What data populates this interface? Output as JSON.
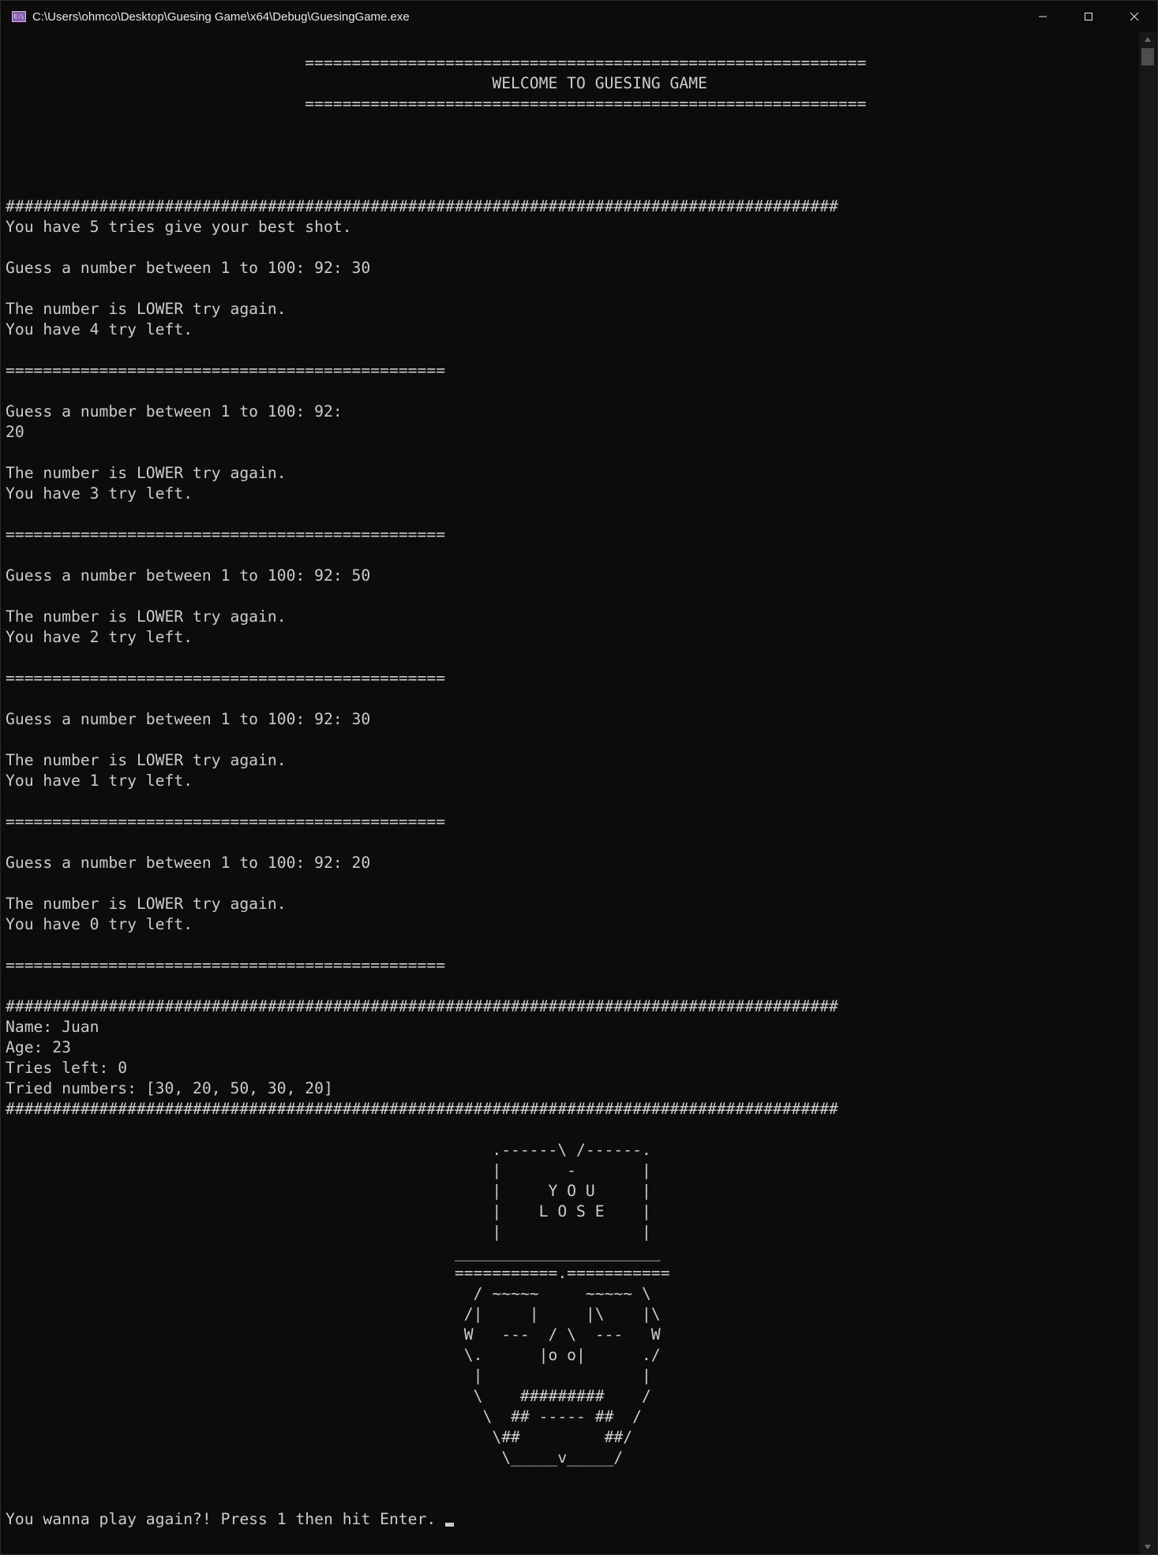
{
  "window": {
    "title": "C:\\Users\\ohmco\\Desktop\\Guesing Game\\x64\\Debug\\GuesingGame.exe",
    "icon": "console-app-icon",
    "icon_text": "C:\\",
    "controls": [
      "minimize-icon",
      "maximize-icon",
      "close-icon"
    ]
  },
  "console": {
    "lines": [
      "",
      "                                ============================================================",
      "                                                    WELCOME TO GUESING GAME",
      "                                ============================================================",
      "",
      "",
      "",
      "",
      "#########################################################################################",
      "You have 5 tries give your best shot.",
      "",
      "Guess a number between 1 to 100: 92: 30",
      "",
      "The number is LOWER try again.",
      "You have 4 try left.",
      "",
      "===============================================",
      "",
      "Guess a number between 1 to 100: 92:",
      "20",
      "",
      "The number is LOWER try again.",
      "You have 3 try left.",
      "",
      "===============================================",
      "",
      "Guess a number between 1 to 100: 92: 50",
      "",
      "The number is LOWER try again.",
      "You have 2 try left.",
      "",
      "===============================================",
      "",
      "Guess a number between 1 to 100: 92: 30",
      "",
      "The number is LOWER try again.",
      "You have 1 try left.",
      "",
      "===============================================",
      "",
      "Guess a number between 1 to 100: 92: 20",
      "",
      "The number is LOWER try again.",
      "You have 0 try left.",
      "",
      "===============================================",
      "",
      "#########################################################################################",
      "Name: Juan",
      "Age: 23",
      "Tries left: 0",
      "Tried numbers: [30, 20, 50, 30, 20]",
      "#########################################################################################",
      "",
      "                                                    .------\\ /------.",
      "                                                    |       -       |",
      "                                                    |     Y O U     |",
      "                                                    |    L O S E    |",
      "                                                    |               |",
      "                                                ______________________",
      "                                                ===========.===========",
      "                                                  / ~~~~~     ~~~~~ \\",
      "                                                 /|     |     |\\    |\\",
      "                                                 W   ---  / \\  ---   W",
      "                                                 \\.      |o o|      ./",
      "                                                  |                 |",
      "                                                  \\    #########    /",
      "                                                   \\  ## ----- ##  /",
      "                                                    \\##         ##/",
      "                                                     \\_____v_____/",
      "",
      "",
      "You wanna play again?! Press 1 then hit Enter. "
    ]
  },
  "scrollbar": {
    "up_icon": "scroll-up-arrow-icon",
    "down_icon": "scroll-down-arrow-icon"
  }
}
